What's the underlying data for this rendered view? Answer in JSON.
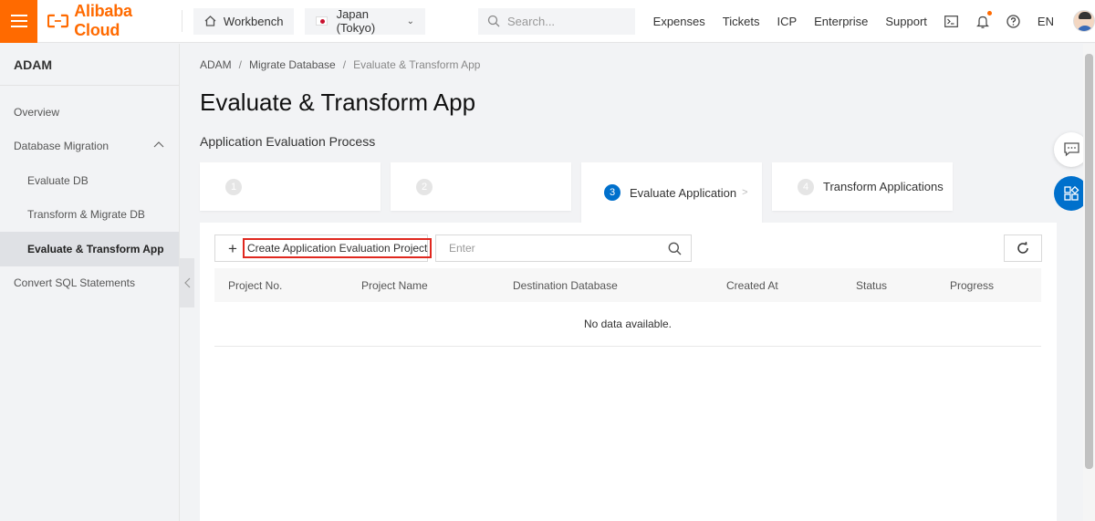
{
  "header": {
    "brand": "Alibaba Cloud",
    "workbench": "Workbench",
    "region": "Japan (Tokyo)",
    "search_placeholder": "Search...",
    "links": [
      "Expenses",
      "Tickets",
      "ICP",
      "Enterprise",
      "Support"
    ],
    "language": "EN",
    "icons": [
      "terminal-icon",
      "bell-icon",
      "help-icon"
    ],
    "brand_color": "#ff6a00"
  },
  "sidebar": {
    "title": "ADAM",
    "items": [
      {
        "label": "Overview"
      },
      {
        "label": "Database Migration"
      },
      {
        "label": "Evaluate DB"
      },
      {
        "label": "Transform & Migrate DB"
      },
      {
        "label": "Evaluate & Transform App"
      },
      {
        "label": "Convert SQL Statements"
      }
    ]
  },
  "breadcrumb": {
    "items": [
      "ADAM",
      "Migrate Database",
      "Evaluate & Transform App"
    ]
  },
  "page": {
    "title": "Evaluate & Transform App",
    "subtitle": "Application Evaluation Process"
  },
  "steps": [
    {
      "num": "1",
      "label": ""
    },
    {
      "num": "2",
      "label": ""
    },
    {
      "num": "3",
      "label": "Evaluate Application",
      "active": true
    },
    {
      "num": "4",
      "label": "Transform Applications"
    }
  ],
  "toolbar": {
    "create_label": "Create Application Evaluation Project",
    "filter_placeholder": "Enter"
  },
  "table": {
    "columns": [
      "Project No.",
      "Project Name",
      "Destination Database",
      "Created At",
      "Status",
      "Progress"
    ],
    "empty_text": "No data available."
  },
  "accent_color": "#0070cc"
}
